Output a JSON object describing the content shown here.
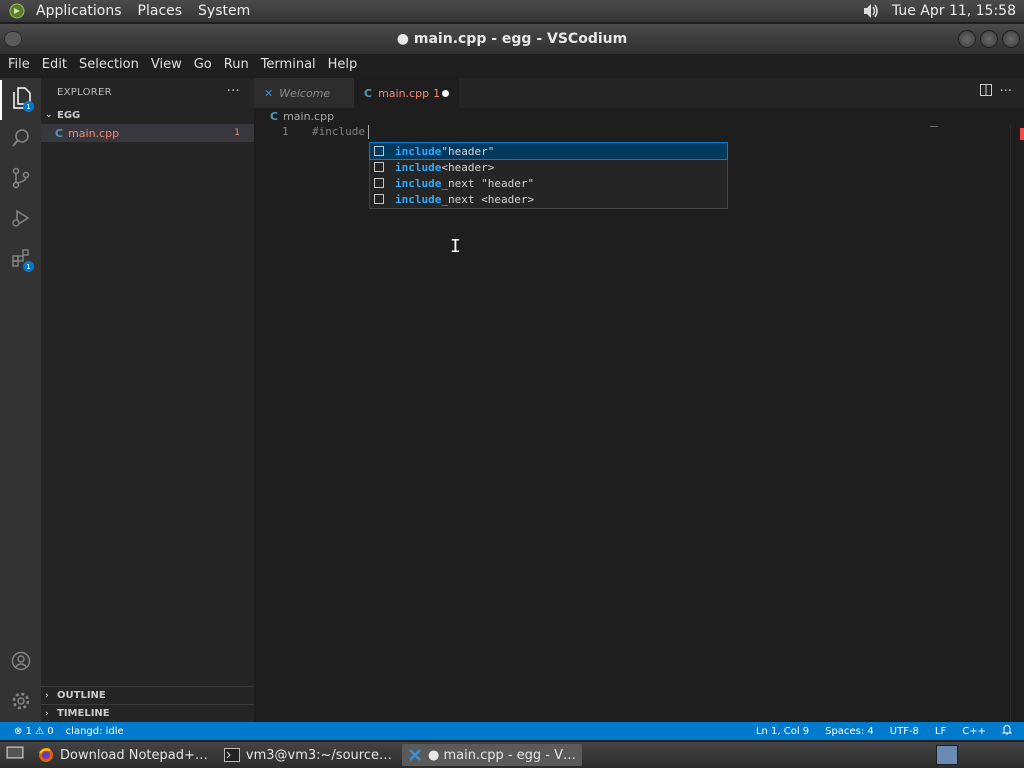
{
  "top_panel": {
    "menus": [
      "Applications",
      "Places",
      "System"
    ],
    "clock": "Tue Apr 11, 15:58"
  },
  "window": {
    "title": "● main.cpp - egg - VSCodium"
  },
  "menubar": [
    "File",
    "Edit",
    "Selection",
    "View",
    "Go",
    "Run",
    "Terminal",
    "Help"
  ],
  "activity": {
    "explorer_badge": "1",
    "extensions_badge": "1"
  },
  "sidebar": {
    "title": "EXPLORER",
    "more": "···",
    "folder": "EGG",
    "file": {
      "name": "main.cpp",
      "problems": "1"
    },
    "outline": "OUTLINE",
    "timeline": "TIMELINE"
  },
  "tabs": {
    "welcome": "Welcome",
    "main": {
      "label": "main.cpp",
      "problems": "1"
    }
  },
  "breadcrumb": "main.cpp",
  "editor": {
    "line_number": "1",
    "line_text": "#include"
  },
  "suggestions": [
    {
      "match": "include",
      "rest": " \"header\""
    },
    {
      "match": "include",
      "rest": " <header>"
    },
    {
      "match": "include",
      "rest": "_next \"header\""
    },
    {
      "match": "include",
      "rest": "_next <header>"
    }
  ],
  "statusbar": {
    "errors": "1",
    "warnings": "0",
    "clangd": "clangd: idle",
    "position": "Ln 1, Col 9",
    "spaces": "Spaces: 4",
    "encoding": "UTF-8",
    "eol": "LF",
    "language": "C++"
  },
  "taskbar": [
    {
      "label": "Download Notepad+…",
      "icon": "firefox-icon"
    },
    {
      "label": "vm3@vm3:~/source…",
      "icon": "terminal-icon"
    },
    {
      "label": "● main.cpp - egg - V…",
      "icon": "vscodium-icon"
    }
  ],
  "colors": {
    "accent": "#007acc",
    "error": "#f48771",
    "selection": "#04395e"
  }
}
